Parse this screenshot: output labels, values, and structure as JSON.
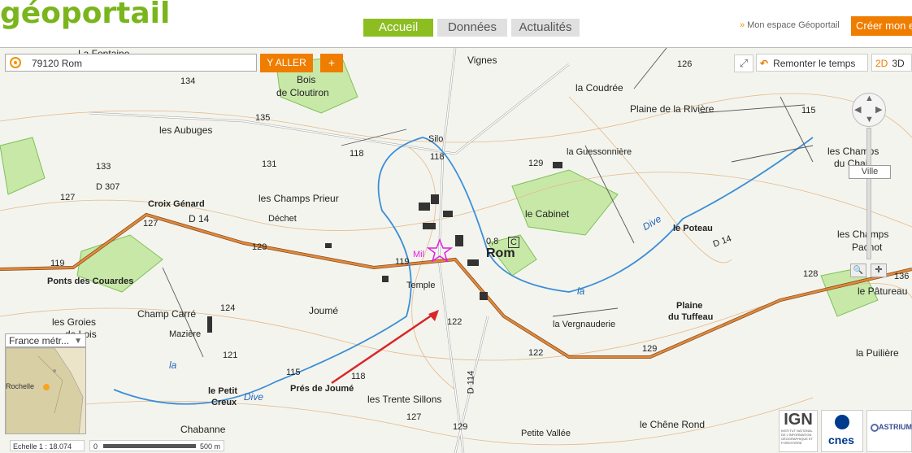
{
  "header": {
    "logo": "géoportail",
    "tabs": [
      {
        "label": "Accueil",
        "active": true
      },
      {
        "label": "Données",
        "active": false
      },
      {
        "label": "Actualités",
        "active": false
      }
    ],
    "espace_link": "Mon espace Géoportail",
    "creer_label": "Créer mon e"
  },
  "toolbar": {
    "search_value": "79120 Rom",
    "yaller_label": "Y ALLER",
    "plus_label": "+",
    "remonter_label": "Remonter le temps",
    "mode_2d": "2D",
    "mode_3d": "3D",
    "zoom_level_label": "Ville"
  },
  "overview": {
    "region_select": "France métr...",
    "place_label": "Rochelle"
  },
  "scale": {
    "echelle_label": "Echelle 1 :  18.074",
    "bar_start": "0",
    "bar_end": "500 m"
  },
  "partners": {
    "ign_name": "IGN",
    "ign_sub": "INSTITUT NATIONAL DE L'INFORMATION GÉOGRAPHIQUE ET FORESTIÈRE",
    "cnes_name": "cnes",
    "astrium_name": "ASTRIUM"
  },
  "map_labels": {
    "rom": "Rom",
    "la_fontaine": "La Fontaine",
    "vignes": "Vignes",
    "bois_cloutiron": "Bois",
    "de_cloutiron": "de Cloutiron",
    "la_coudree": "la Coudrée",
    "plaine_riviere": "Plaine de la Rivière",
    "les_aubuges": "les Aubuges",
    "silo": "Silo",
    "la_guessonniere": "la Guessonnière",
    "les_champs_du_chail": "les Champs",
    "du_chail": "du Chail",
    "croix_genard": "Croix Génard",
    "les_champs_prieur": "les Champs Prieur",
    "le_cabinet": "le Cabinet",
    "dechet": "Déchet",
    "d14": "D 14",
    "d14b": "D 14",
    "d307": "D 307",
    "d114": "D 114",
    "ponts_couardes": "Ponts des Couardes",
    "le_poteau": "le Poteau",
    "les_champs_pacnot": "les Champs",
    "pacnot": "Pacnot",
    "le_patureau": "le Pâtureau",
    "champ_carre": "Champ Carré",
    "joume": "Joumé",
    "temple": "Temple",
    "les_groies": "les Groies",
    "de_lois": "de Lois",
    "maziere": "Mazière",
    "la_vergnauderie": "la Vergnauderie",
    "plaine_tuffeau": "Plaine",
    "du_tuffeau": "du Tuffeau",
    "la_puiliere": "la Puilière",
    "le_petit_creux": "le Petit",
    "creux": "Creux",
    "pres_de_joume": "Prés de Joumé",
    "les_trente_sillons": "les Trente Sillons",
    "chabanne": "Chabanne",
    "petite_vallee": "Petite Vallée",
    "le_chene_rond": "le Chêne Rond",
    "dive1": "Dive",
    "dive2": "Dive",
    "la1": "la",
    "la2": "la",
    "la3": "la",
    "mil": "Mil",
    "val_08": "0,8",
    "c_box": "C",
    "alt_134": "134",
    "alt_135": "135",
    "alt_133": "133",
    "alt_127a": "127",
    "alt_127b": "127",
    "alt_118a": "118",
    "alt_118b": "118",
    "alt_118c": "118",
    "alt_131": "131",
    "alt_129a": "129",
    "alt_129b": "129",
    "alt_129c": "129",
    "alt_129d": "129",
    "alt_119a": "119",
    "alt_119b": "119",
    "alt_124": "124",
    "alt_121": "121",
    "alt_115a": "115",
    "alt_115b": "115",
    "alt_122a": "122",
    "alt_122b": "122",
    "alt_126": "126",
    "alt_128": "128",
    "alt_127c": "127",
    "alt_136": "136"
  }
}
